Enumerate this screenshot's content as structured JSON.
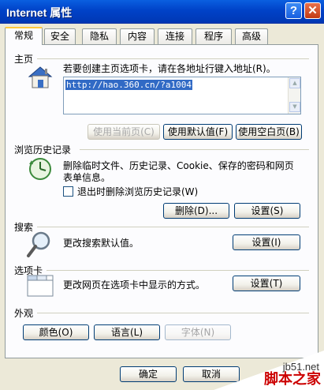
{
  "window": {
    "title": "Internet 属性",
    "help_glyph": "?",
    "close_glyph": "✕"
  },
  "tabs": [
    "常规",
    "安全",
    "隐私",
    "内容",
    "连接",
    "程序",
    "高级"
  ],
  "home": {
    "section": "主页",
    "prompt": "若要创建主页选项卡，请在各地址行键入地址(R)。",
    "address": "http://hao.360.cn/?a1004",
    "btn_current": "使用当前页(C)",
    "btn_default": "使用默认值(F)",
    "btn_blank": "使用空白页(B)"
  },
  "history": {
    "section": "浏览历史记录",
    "desc_line1": "删除临时文件、历史记录、Cookie、保存的密码和网页",
    "desc_line2": "表单信息。",
    "checkbox_label": "退出时删除浏览历史记录(W)",
    "btn_delete": "删除(D)...",
    "btn_settings": "设置(S)"
  },
  "search": {
    "section": "搜索",
    "desc": "更改搜索默认值。",
    "btn_settings": "设置(I)"
  },
  "tabsec": {
    "section": "选项卡",
    "desc": "更改网页在选项卡中显示的方式。",
    "btn_settings": "设置(T)"
  },
  "appearance": {
    "section": "外观",
    "btn_colors": "颜色(O)",
    "btn_languages": "语言(L)",
    "btn_fonts": "字体(N)"
  },
  "footer": {
    "btn_ok": "确定",
    "btn_cancel": "取消"
  },
  "watermark": {
    "site": "jb51.net",
    "name": "脚本之家"
  }
}
